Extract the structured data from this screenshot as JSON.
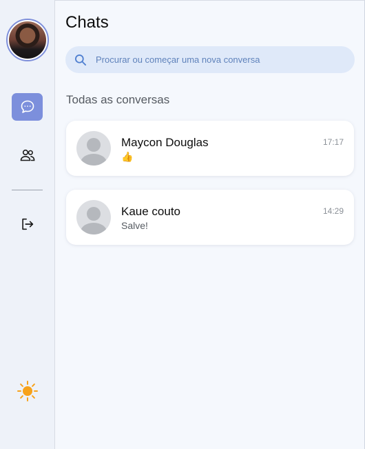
{
  "sidebar": {
    "avatar_alt": "profile-photo",
    "icons": {
      "chats": "chat-bubble-icon",
      "contacts": "users-icon",
      "logout": "logout-icon",
      "theme": "sun-icon"
    },
    "accent": "#7c8fdc",
    "sun_color": "#f7a21b"
  },
  "main": {
    "title": "Chats",
    "search": {
      "placeholder": "Procurar ou começar uma nova conversa"
    },
    "section_title": "Todas as conversas",
    "chats": [
      {
        "name": "Maycon Douglas",
        "message": "👍",
        "time": "17:17"
      },
      {
        "name": "Kaue couto",
        "message": "Salve!",
        "time": "14:29"
      }
    ]
  }
}
